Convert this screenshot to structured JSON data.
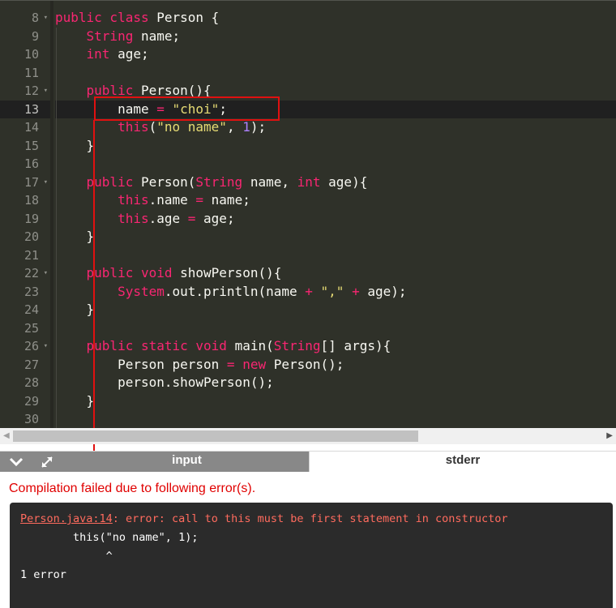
{
  "editor": {
    "lines": [
      {
        "num": "8",
        "fold": true,
        "tokens": [
          [
            "kw2",
            "public class "
          ],
          [
            "plain",
            "Person {"
          ]
        ]
      },
      {
        "num": "9",
        "fold": false,
        "tokens": [
          [
            "plain",
            "    "
          ],
          [
            "kw",
            "String"
          ],
          [
            "plain",
            " name;"
          ]
        ]
      },
      {
        "num": "10",
        "fold": false,
        "tokens": [
          [
            "plain",
            "    "
          ],
          [
            "kw",
            "int"
          ],
          [
            "plain",
            " age;"
          ]
        ]
      },
      {
        "num": "11",
        "fold": false,
        "tokens": []
      },
      {
        "num": "12",
        "fold": true,
        "tokens": [
          [
            "plain",
            "    "
          ],
          [
            "kw",
            "public"
          ],
          [
            "plain",
            " Person(){"
          ]
        ]
      },
      {
        "num": "13",
        "fold": false,
        "active": true,
        "tokens": [
          [
            "plain",
            "        name "
          ],
          [
            "kw",
            "="
          ],
          [
            "plain",
            " "
          ],
          [
            "st",
            "\"choi\""
          ],
          [
            "plain",
            ";"
          ]
        ]
      },
      {
        "num": "14",
        "fold": false,
        "tokens": [
          [
            "plain",
            "        "
          ],
          [
            "kw",
            "this"
          ],
          [
            "plain",
            "("
          ],
          [
            "st",
            "\"no name\""
          ],
          [
            "plain",
            ", "
          ],
          [
            "nm",
            "1"
          ],
          [
            "plain",
            ");"
          ]
        ]
      },
      {
        "num": "15",
        "fold": false,
        "tokens": [
          [
            "plain",
            "    }"
          ]
        ]
      },
      {
        "num": "16",
        "fold": false,
        "tokens": []
      },
      {
        "num": "17",
        "fold": true,
        "tokens": [
          [
            "plain",
            "    "
          ],
          [
            "kw",
            "public"
          ],
          [
            "plain",
            " Person("
          ],
          [
            "kw",
            "String"
          ],
          [
            "plain",
            " name, "
          ],
          [
            "kw",
            "int"
          ],
          [
            "plain",
            " age){"
          ]
        ]
      },
      {
        "num": "18",
        "fold": false,
        "tokens": [
          [
            "plain",
            "        "
          ],
          [
            "kw",
            "this"
          ],
          [
            "plain",
            ".name "
          ],
          [
            "kw",
            "="
          ],
          [
            "plain",
            " name;"
          ]
        ]
      },
      {
        "num": "19",
        "fold": false,
        "tokens": [
          [
            "plain",
            "        "
          ],
          [
            "kw",
            "this"
          ],
          [
            "plain",
            ".age "
          ],
          [
            "kw",
            "="
          ],
          [
            "plain",
            " age;"
          ]
        ]
      },
      {
        "num": "20",
        "fold": false,
        "tokens": [
          [
            "plain",
            "    }"
          ]
        ]
      },
      {
        "num": "21",
        "fold": false,
        "tokens": []
      },
      {
        "num": "22",
        "fold": true,
        "tokens": [
          [
            "plain",
            "    "
          ],
          [
            "kw",
            "public"
          ],
          [
            "plain",
            " "
          ],
          [
            "kw",
            "void"
          ],
          [
            "plain",
            " showPerson(){"
          ]
        ]
      },
      {
        "num": "23",
        "fold": false,
        "tokens": [
          [
            "plain",
            "        "
          ],
          [
            "kw",
            "System"
          ],
          [
            "plain",
            ".out.println(name "
          ],
          [
            "kw",
            "+"
          ],
          [
            "plain",
            " "
          ],
          [
            "st",
            "\",\""
          ],
          [
            "plain",
            " "
          ],
          [
            "kw",
            "+"
          ],
          [
            "plain",
            " age);"
          ]
        ]
      },
      {
        "num": "24",
        "fold": false,
        "tokens": [
          [
            "plain",
            "    }"
          ]
        ]
      },
      {
        "num": "25",
        "fold": false,
        "tokens": []
      },
      {
        "num": "26",
        "fold": true,
        "tokens": [
          [
            "plain",
            "    "
          ],
          [
            "kw",
            "public"
          ],
          [
            "plain",
            " "
          ],
          [
            "kw",
            "static"
          ],
          [
            "plain",
            " "
          ],
          [
            "kw",
            "void"
          ],
          [
            "plain",
            " main("
          ],
          [
            "kw",
            "String"
          ],
          [
            "plain",
            "[] args){"
          ]
        ]
      },
      {
        "num": "27",
        "fold": false,
        "tokens": [
          [
            "plain",
            "        Person person "
          ],
          [
            "kw",
            "="
          ],
          [
            "plain",
            " "
          ],
          [
            "kw",
            "new"
          ],
          [
            "plain",
            " Person();"
          ]
        ]
      },
      {
        "num": "28",
        "fold": false,
        "tokens": [
          [
            "plain",
            "        person.showPerson();"
          ]
        ]
      },
      {
        "num": "29",
        "fold": false,
        "tokens": [
          [
            "plain",
            "    }"
          ]
        ]
      },
      {
        "num": "30",
        "fold": false,
        "tokens": []
      }
    ]
  },
  "tabs": {
    "input_label": "input",
    "stderr_label": "stderr"
  },
  "output": {
    "status": "Compilation failed due to following error(s).",
    "console": {
      "file_ref": "Person.java:14",
      "message": ": error: call to this must be first statement in constructor",
      "line2": "        this(\"no name\", 1);",
      "line3": "             ^",
      "line4": "1 error"
    }
  },
  "colors": {
    "editor_bg": "#2f3129",
    "keyword": "#f92672",
    "string": "#e6db74",
    "number": "#ae81ff",
    "annotation_red": "#e01010",
    "error_text": "#ff6b5e"
  },
  "icons": [
    "chevron-down-icon",
    "expand-arrows-icon",
    "scroll-left-icon",
    "scroll-right-icon"
  ]
}
